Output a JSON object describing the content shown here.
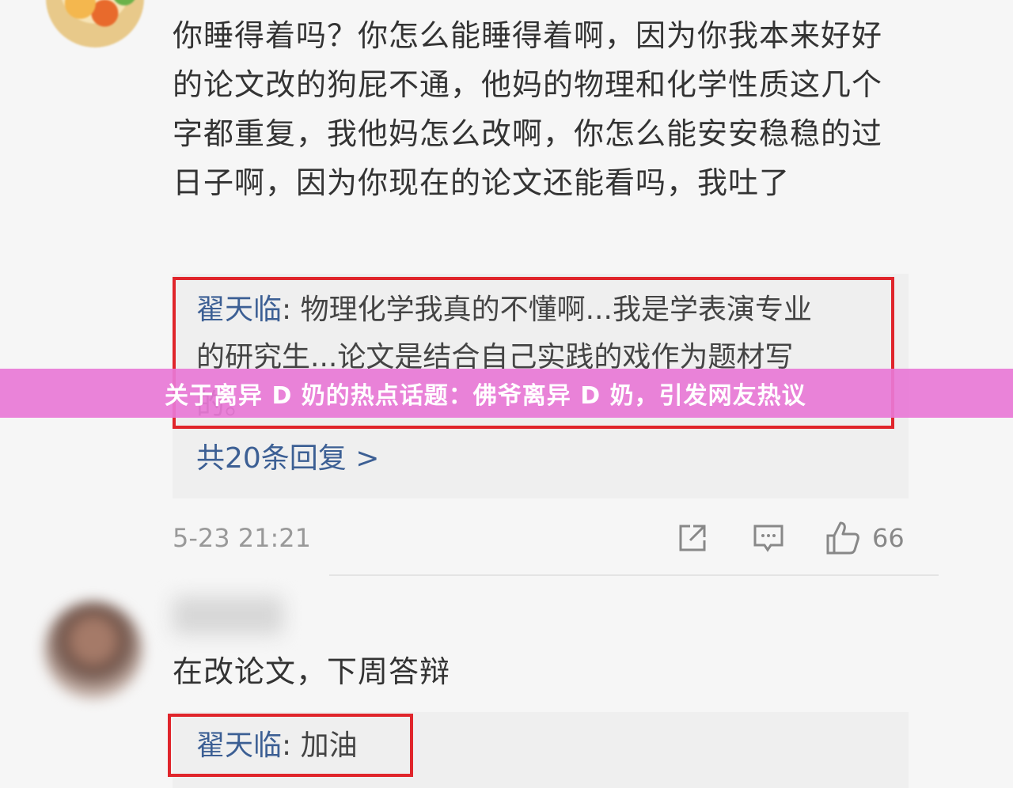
{
  "comment_1": {
    "text": "你睡得着吗？你怎么能睡得着啊，因为你我本来好好的论文改的狗屁不通，他妈的物理和化学性质这几个字都重复，我他妈怎么改啊，你怎么能安安稳稳的过日子啊，因为你现在的论文还能看吗，我吐了",
    "reply": {
      "author": "翟天临",
      "separator": ":",
      "line_1": "物理化学我真的不懂啊...我是学表演专业",
      "line_2": "的研究生...论文是结合自己实践的戏作为题材写",
      "line_3": "的。"
    },
    "more_replies": "共20条回复 >",
    "timestamp": "5-23 21:21",
    "like_count": "66",
    "icons": {
      "share": "share-icon",
      "comment": "comment-icon",
      "like": "like-icon"
    }
  },
  "comment_2": {
    "text": "在改论文，下周答辩",
    "reply": {
      "author": "翟天临",
      "separator": ":",
      "text": "加油"
    }
  },
  "overlay": {
    "title": "关于离异 D 奶的热点话题：佛爷离异 D 奶，引发网友热议"
  },
  "colors": {
    "link": "#3c5f94",
    "highlight_border": "#e0252b",
    "overlay": "#e878d6"
  }
}
